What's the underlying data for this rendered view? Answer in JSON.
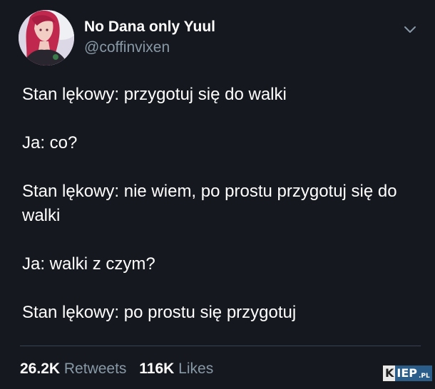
{
  "author": {
    "display_name": "No Dana only Yuul",
    "handle": "@coffinvixen",
    "avatar_icon": "profile-avatar"
  },
  "menu_icon": "chevron-down-icon",
  "tweet_paragraphs": [
    "Stan lękowy: przygotuj się do walki",
    "Ja: co?",
    "Stan lękowy: nie wiem, po prostu przygotuj się do walki",
    "Ja: walki z czym?",
    "Stan lękowy: po prostu się przygotuj"
  ],
  "stats": {
    "retweets_count": "26.2K",
    "retweets_label": "Retweets",
    "likes_count": "116K",
    "likes_label": "Likes"
  },
  "watermark": {
    "text": "KIEP.PL"
  },
  "colors": {
    "background": "#15181f",
    "text_primary": "#ffffff",
    "text_secondary": "#8899a6",
    "divider": "#38444d"
  }
}
